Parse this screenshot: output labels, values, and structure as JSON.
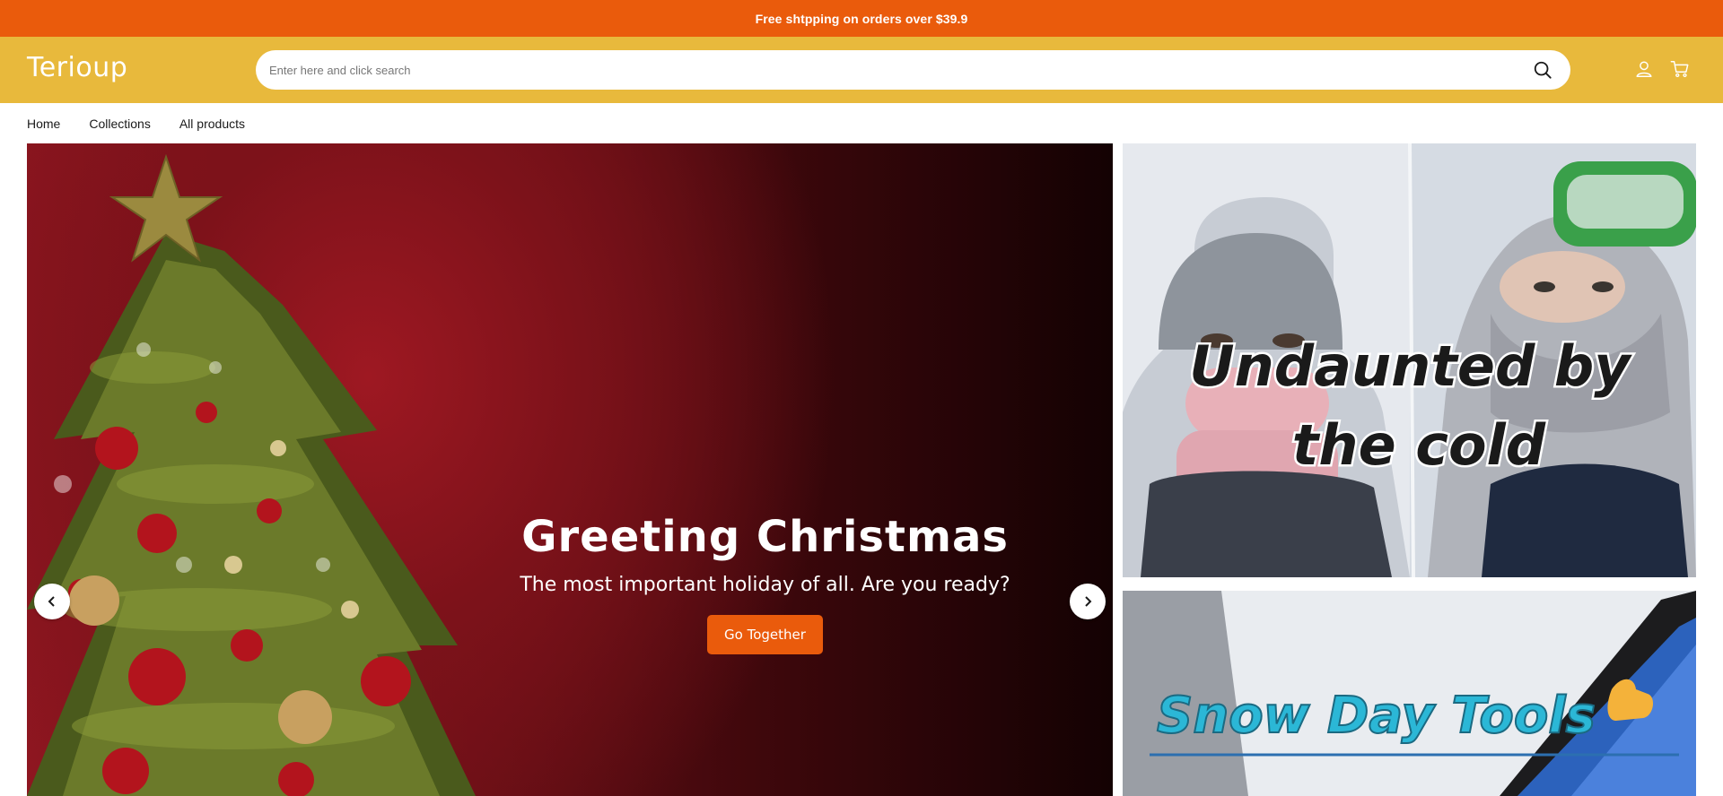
{
  "announcement": {
    "text": "Free shtpping on orders over $39.9"
  },
  "header": {
    "logo": "Terioup",
    "search_placeholder": "Enter here and click search",
    "icons": [
      "search-icon",
      "account-icon",
      "cart-icon"
    ]
  },
  "nav": {
    "items": [
      {
        "label": "Home"
      },
      {
        "label": "Collections"
      },
      {
        "label": "All products"
      }
    ]
  },
  "hero": {
    "title": "Greeting Christmas",
    "subtitle": "The most important holiday of all. Are you ready?",
    "button_label": "Go Together",
    "icons": [
      "chevron-left-icon",
      "chevron-right-icon"
    ]
  },
  "banners": [
    {
      "text_line1": "Undaunted by",
      "text_line2": "the cold"
    },
    {
      "text": "Snow Day Tools"
    }
  ],
  "colors": {
    "announcement_bg": "#ea5b0c",
    "header_bg": "#e8b93c",
    "accent": "#ea5b0c",
    "hero_red": "#8e1620"
  }
}
